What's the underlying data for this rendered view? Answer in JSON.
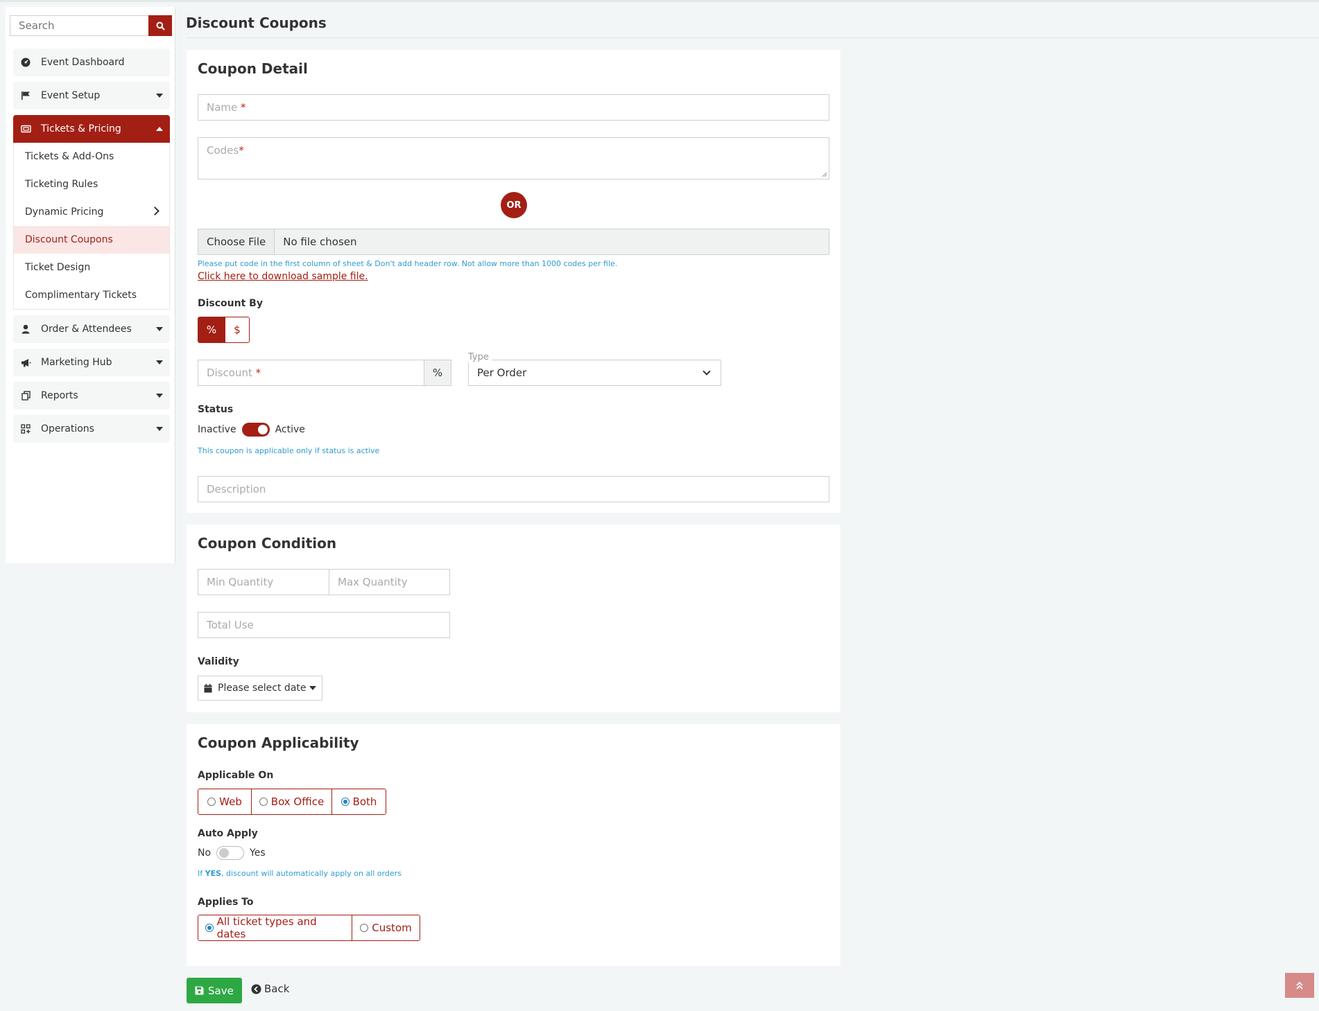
{
  "search": {
    "placeholder": "Search"
  },
  "sidebar": {
    "items": [
      {
        "label": "Event Dashboard"
      },
      {
        "label": "Event Setup"
      },
      {
        "label": "Tickets & Pricing"
      },
      {
        "label": "Order & Attendees"
      },
      {
        "label": "Marketing Hub"
      },
      {
        "label": "Reports"
      },
      {
        "label": "Operations"
      }
    ],
    "sub_items": [
      {
        "label": "Tickets & Add-Ons"
      },
      {
        "label": "Ticketing Rules"
      },
      {
        "label": "Dynamic Pricing"
      },
      {
        "label": "Discount Coupons"
      },
      {
        "label": "Ticket Design"
      },
      {
        "label": "Complimentary Tickets"
      }
    ]
  },
  "page": {
    "title": "Discount Coupons"
  },
  "coupon_detail": {
    "title": "Coupon Detail",
    "name_placeholder": "Name",
    "codes_placeholder": "Codes",
    "required_mark": "*",
    "or_label": "OR",
    "choose_file": "Choose File",
    "no_file": "No file chosen",
    "file_hint": "Please put code in the first column of sheet & Don't add header row. Not allow more than 1000 codes per file.",
    "download_link": "Click here to download sample file.",
    "discount_by_label": "Discount By",
    "discount_by_options": [
      "%",
      "$"
    ],
    "discount_placeholder": "Discount",
    "discount_unit": "%",
    "type_label": "Type",
    "type_value": "Per Order",
    "status_label": "Status",
    "status_off": "Inactive",
    "status_on": "Active",
    "status_hint": "This coupon is applicable only if status is active",
    "description_placeholder": "Description"
  },
  "coupon_condition": {
    "title": "Coupon Condition",
    "min_placeholder": "Min Quantity",
    "max_placeholder": "Max Quantity",
    "total_placeholder": "Total Use",
    "validity_label": "Validity",
    "date_button": "Please select date"
  },
  "coupon_applicability": {
    "title": "Coupon Applicability",
    "applicable_on_label": "Applicable On",
    "applicable_options": [
      "Web",
      "Box Office",
      "Both"
    ],
    "auto_apply_label": "Auto Apply",
    "auto_no": "No",
    "auto_yes": "Yes",
    "auto_hint_prefix": "If ",
    "auto_hint_strong": "YES",
    "auto_hint_suffix": ", discount will automatically apply on all orders",
    "applies_to_label": "Applies To",
    "applies_to_options": [
      "All ticket types and dates",
      "Custom"
    ]
  },
  "actions": {
    "save": "Save",
    "back": "Back"
  },
  "colors": {
    "brand": "#a31f14",
    "save": "#2ea843",
    "hint": "#2f9bd0"
  }
}
